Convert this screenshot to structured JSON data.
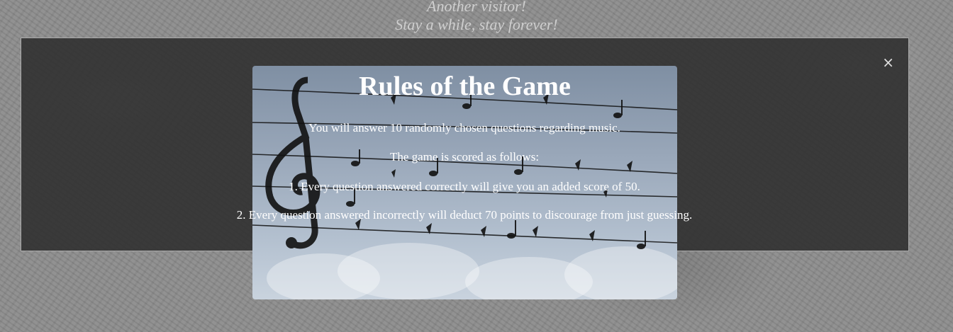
{
  "header": {
    "line1": "Another visitor!",
    "line2": "Stay a while, stay forever!"
  },
  "modal": {
    "close_label": "×",
    "title": "Rules of the Game",
    "rules": [
      "You will answer 10 randomly chosen questions regarding music.",
      "The game is scored as follows:",
      "1. Every question answered correctly will give you an added score of 50.",
      "2. Every question answered incorrectly will deduct 70 points to discourage from just guessing."
    ]
  },
  "colors": {
    "overlay": "#2d2d2d",
    "text": "#ffffff",
    "header_text": "#cfcfcf"
  },
  "icons": {
    "close": "close-icon",
    "treble_clef": "treble-clef-icon"
  }
}
